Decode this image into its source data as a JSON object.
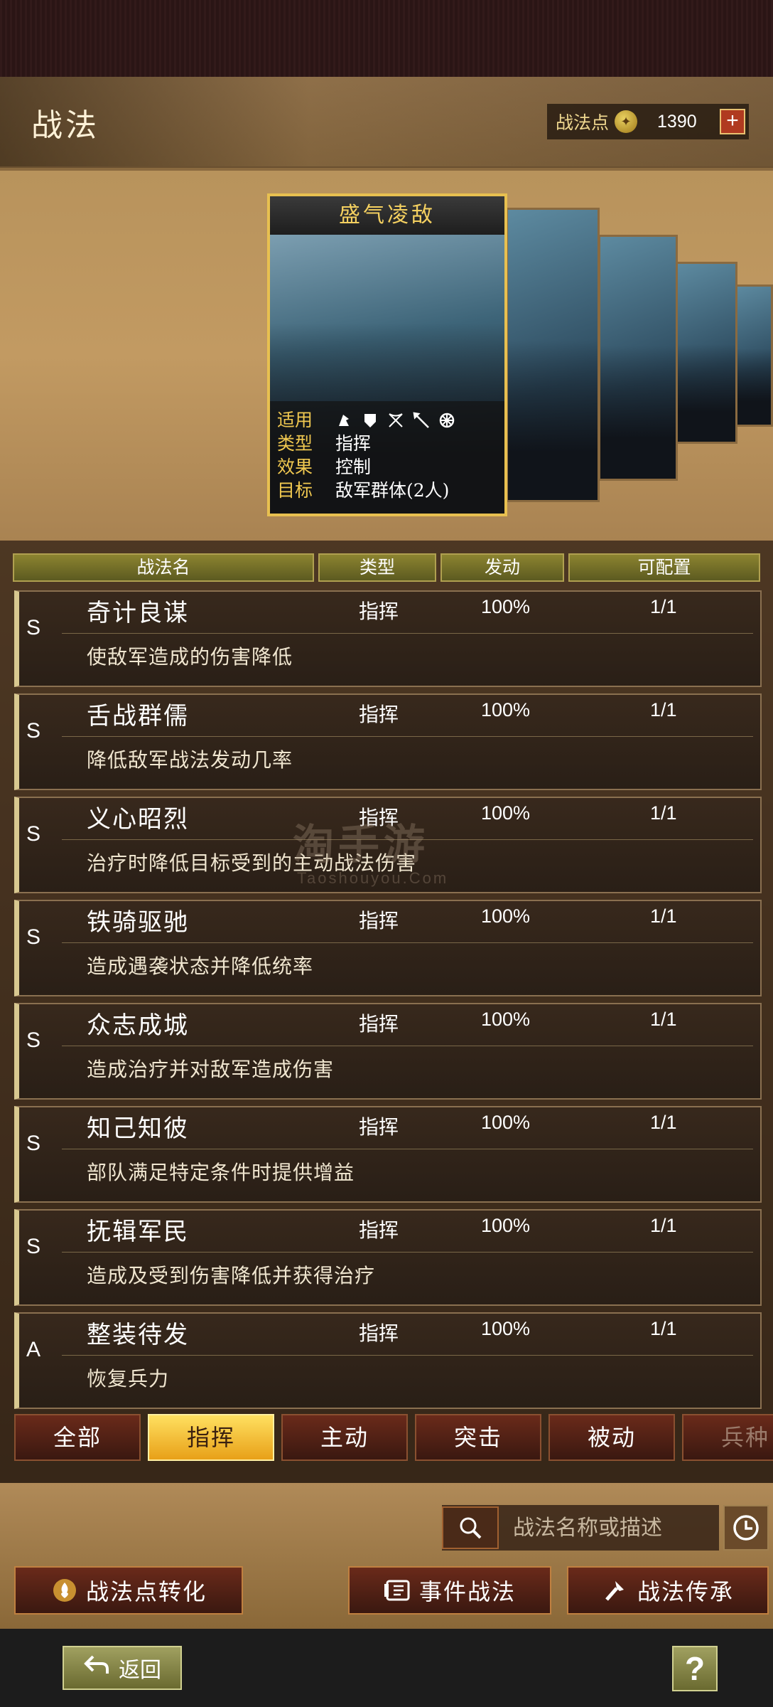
{
  "header": {
    "title": "战法",
    "points_label": "战法点",
    "points_value": "1390"
  },
  "featured": {
    "name": "盛气凌敌",
    "fields": [
      {
        "key": "适用",
        "value": ""
      },
      {
        "key": "类型",
        "value": "指挥"
      },
      {
        "key": "效果",
        "value": "控制"
      },
      {
        "key": "目标",
        "value": "敌军群体(2人)"
      }
    ],
    "unit_icons": [
      "cavalry-icon",
      "shield-icon",
      "bow-icon",
      "spear-icon",
      "chariot-icon"
    ]
  },
  "table": {
    "headers": {
      "name": "战法名",
      "type": "类型",
      "rate": "发动",
      "config": "可配置"
    },
    "rows": [
      {
        "grade": "S",
        "name": "奇计良谋",
        "type": "指挥",
        "rate": "100%",
        "config": "1/1",
        "desc": "使敌军造成的伤害降低"
      },
      {
        "grade": "S",
        "name": "舌战群儒",
        "type": "指挥",
        "rate": "100%",
        "config": "1/1",
        "desc": "降低敌军战法发动几率"
      },
      {
        "grade": "S",
        "name": "义心昭烈",
        "type": "指挥",
        "rate": "100%",
        "config": "1/1",
        "desc": "治疗时降低目标受到的主动战法伤害"
      },
      {
        "grade": "S",
        "name": "铁骑驱驰",
        "type": "指挥",
        "rate": "100%",
        "config": "1/1",
        "desc": "造成遇袭状态并降低统率"
      },
      {
        "grade": "S",
        "name": "众志成城",
        "type": "指挥",
        "rate": "100%",
        "config": "1/1",
        "desc": "造成治疗并对敌军造成伤害"
      },
      {
        "grade": "S",
        "name": "知己知彼",
        "type": "指挥",
        "rate": "100%",
        "config": "1/1",
        "desc": "部队满足特定条件时提供增益"
      },
      {
        "grade": "S",
        "name": "抚辑军民",
        "type": "指挥",
        "rate": "100%",
        "config": "1/1",
        "desc": "造成及受到伤害降低并获得治疗"
      },
      {
        "grade": "A",
        "name": "整装待发",
        "type": "指挥",
        "rate": "100%",
        "config": "1/1",
        "desc": "恢复兵力"
      }
    ]
  },
  "watermark": {
    "text": "淘手游",
    "sub": "Taoshouyou.Com"
  },
  "tabs": [
    {
      "label": "全部",
      "active": false
    },
    {
      "label": "指挥",
      "active": true
    },
    {
      "label": "主动",
      "active": false
    },
    {
      "label": "突击",
      "active": false
    },
    {
      "label": "被动",
      "active": false
    },
    {
      "label": "兵种",
      "active": false
    }
  ],
  "search": {
    "placeholder": "战法名称或描述"
  },
  "buttons": {
    "convert": "战法点转化",
    "event": "事件战法",
    "inherit": "战法传承",
    "back": "返回",
    "help": "?"
  },
  "colors": {
    "accent": "#e8c050",
    "tab_active": "#f5c030",
    "button_bg": "#4a1e12"
  }
}
